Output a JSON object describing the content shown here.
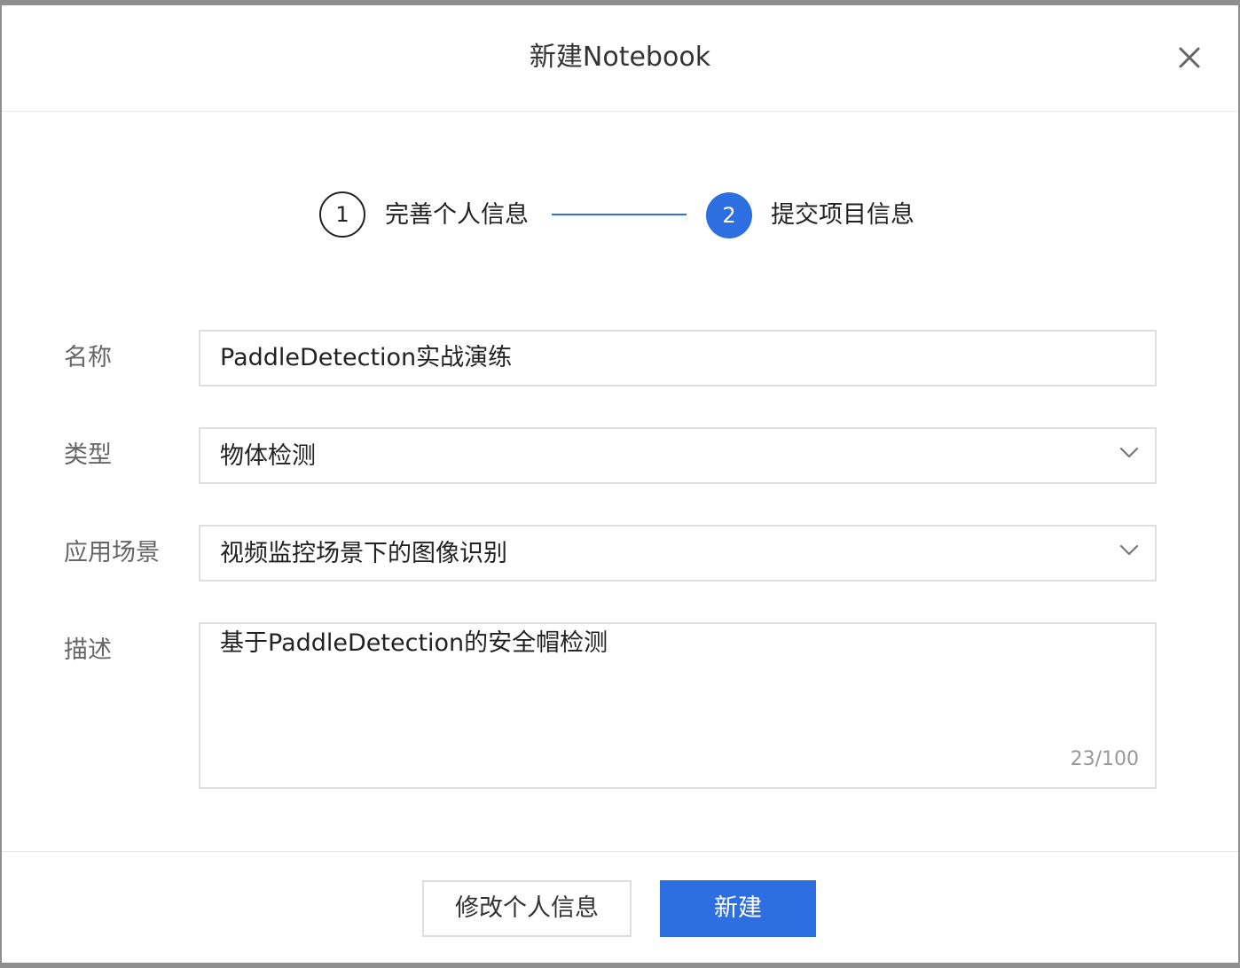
{
  "modal": {
    "title": "新建Notebook"
  },
  "steps": [
    {
      "number": "1",
      "label": "完善个人信息",
      "state": "done"
    },
    {
      "number": "2",
      "label": "提交项目信息",
      "state": "active"
    }
  ],
  "form": {
    "name": {
      "label": "名称",
      "value": "PaddleDetection实战演练"
    },
    "type": {
      "label": "类型",
      "value": "物体检测"
    },
    "scenario": {
      "label": "应用场景",
      "value": "视频监控场景下的图像识别"
    },
    "description": {
      "label": "描述",
      "value": "基于PaddleDetection的安全帽检测",
      "counter": "23/100"
    }
  },
  "footer": {
    "secondary_label": "修改个人信息",
    "primary_label": "新建"
  },
  "colors": {
    "primary": "#2d6fe0",
    "border": "#dedede",
    "label": "#666666"
  },
  "icons": {
    "close": "close-icon",
    "dropdown": "chevron-down-icon"
  }
}
